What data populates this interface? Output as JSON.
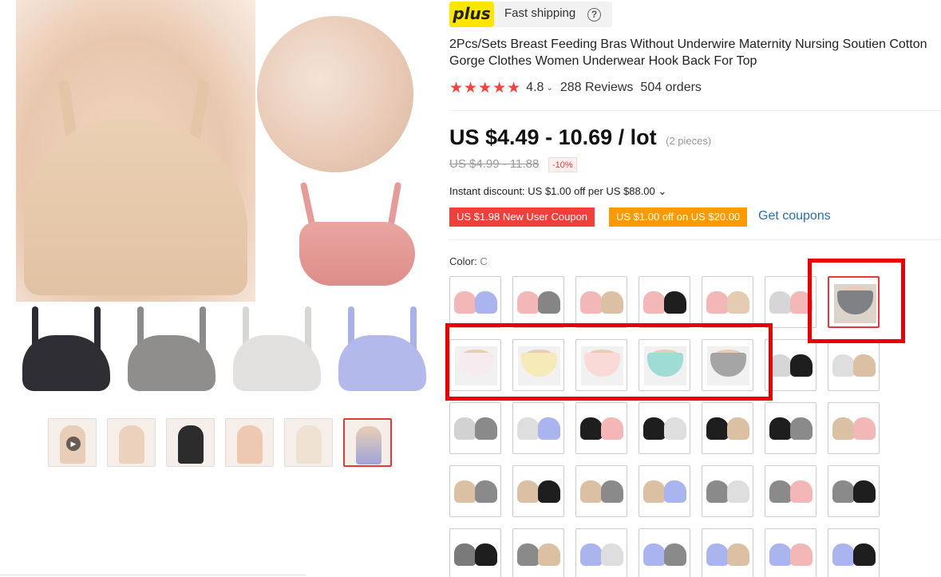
{
  "badge": {
    "plus_label": "plus",
    "shipping_label": "Fast shipping"
  },
  "product": {
    "title": "2Pcs/Sets Breast Feeding Bras Without Underwire Maternity Nursing Soutien Cotton Gorge Clothes Women Underwear Hook Back For Top",
    "stars": "★★★★★",
    "rating": "4.8",
    "reviews": "288 Reviews",
    "orders": "504 orders",
    "price": "US $4.49 - 10.69 / lot",
    "price_unit": "(2 pieces)",
    "old_price": "US $4.99 - 11.88",
    "discount_badge": "-10%",
    "instant_discount": "Instant discount: US $1.00 off per US $88.00 ⌄"
  },
  "coupons": {
    "new_user": "US $1.98 New User Coupon",
    "off": "US $1.00 off on US $20.00",
    "get_coupons": "Get coupons"
  },
  "color": {
    "label": "Color:",
    "value": "C"
  },
  "colors": {
    "red": "#e4393c",
    "highlight": "#e90000",
    "coupon_orange": "#fe9a00",
    "link_blue": "#2a6db1",
    "star_red": "#f0453f"
  },
  "gallery": {
    "variants": [
      "black",
      "gray",
      "white",
      "lavender"
    ],
    "thumbnail_count": 6,
    "active_thumbnail": 6
  },
  "swatches": [
    [
      "pink+lavender",
      "pink+gray",
      "pink+beige",
      "black+pink",
      "pink+beige",
      "white+pink",
      "gray-underwear"
    ],
    [
      "white-underwear",
      "yellow-underwear",
      "pink-underwear",
      "mint-underwear",
      "gray-underwear",
      "white+black",
      "white+beige"
    ],
    [
      "white+gray",
      "white+lavender",
      "black+pink",
      "black+white",
      "black+beige",
      "black+gray",
      "beige+pink"
    ],
    [
      "beige+gray",
      "beige+black",
      "beige+gray",
      "beige+lavender",
      "gray+white",
      "gray+pink",
      "gray+black"
    ],
    [
      "gray+black",
      "gray+beige",
      "lavender+white",
      "lavender+gray",
      "lavender+beige",
      "lavender+pink",
      "lavender+black"
    ]
  ],
  "selected_swatch": "row 1, item 7"
}
